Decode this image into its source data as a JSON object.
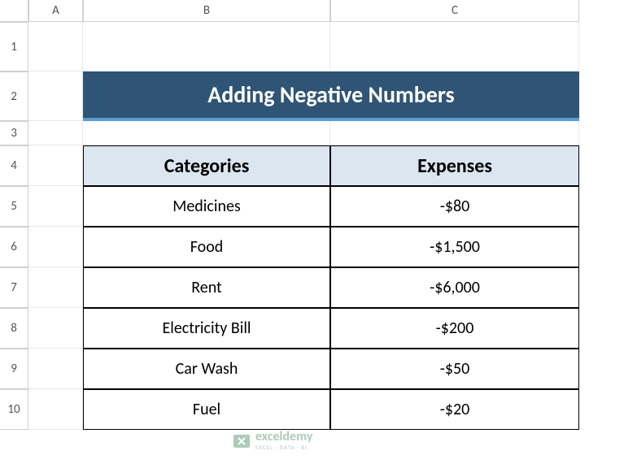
{
  "columns": [
    "A",
    "B",
    "C"
  ],
  "rows": [
    "1",
    "2",
    "3",
    "4",
    "5",
    "6",
    "7",
    "8",
    "9",
    "10"
  ],
  "title": "Adding Negative Numbers",
  "headers": {
    "categories": "Categories",
    "expenses": "Expenses"
  },
  "table": [
    {
      "category": "Medicines",
      "expense": "-$80"
    },
    {
      "category": "Food",
      "expense": "-$1,500"
    },
    {
      "category": "Rent",
      "expense": "-$6,000"
    },
    {
      "category": "Electricity Bill",
      "expense": "-$200"
    },
    {
      "category": "Car Wash",
      "expense": "-$50"
    },
    {
      "category": "Fuel",
      "expense": "-$20"
    }
  ],
  "watermark": {
    "name": "exceldemy",
    "tagline": "EXCEL · DATA · BI"
  }
}
